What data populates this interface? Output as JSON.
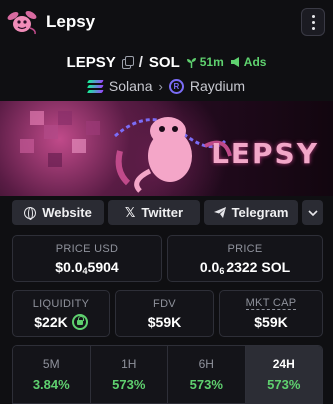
{
  "header": {
    "app_name": "Lepsy"
  },
  "pair": {
    "base": "LEPSY",
    "separator": "/",
    "quote": "SOL",
    "age": "51m",
    "ads_label": "Ads"
  },
  "chain": {
    "network": "Solana",
    "dex": "Raydium"
  },
  "banner": {
    "text": "LEPSY"
  },
  "links": {
    "website": "Website",
    "twitter": "Twitter",
    "telegram": "Telegram"
  },
  "price": {
    "usd_label": "PRICE USD",
    "usd_prefix": "$0.0",
    "usd_zeros": "4",
    "usd_rest": "5904",
    "native_label": "PRICE",
    "native_prefix": "0.0",
    "native_zeros": "6",
    "native_rest": "2322 SOL"
  },
  "metrics": {
    "liquidity_label": "LIQUIDITY",
    "liquidity_value": "$22K",
    "fdv_label": "FDV",
    "fdv_value": "$59K",
    "mcap_label": "MKT CAP",
    "mcap_value": "$59K"
  },
  "changes": [
    {
      "label": "5M",
      "value": "3.84%"
    },
    {
      "label": "1H",
      "value": "573%"
    },
    {
      "label": "6H",
      "value": "573%"
    },
    {
      "label": "24H",
      "value": "573%"
    }
  ],
  "colors": {
    "positive": "#5fd16f",
    "accent_purple": "#7b6cf6",
    "background": "#0f0f12"
  }
}
